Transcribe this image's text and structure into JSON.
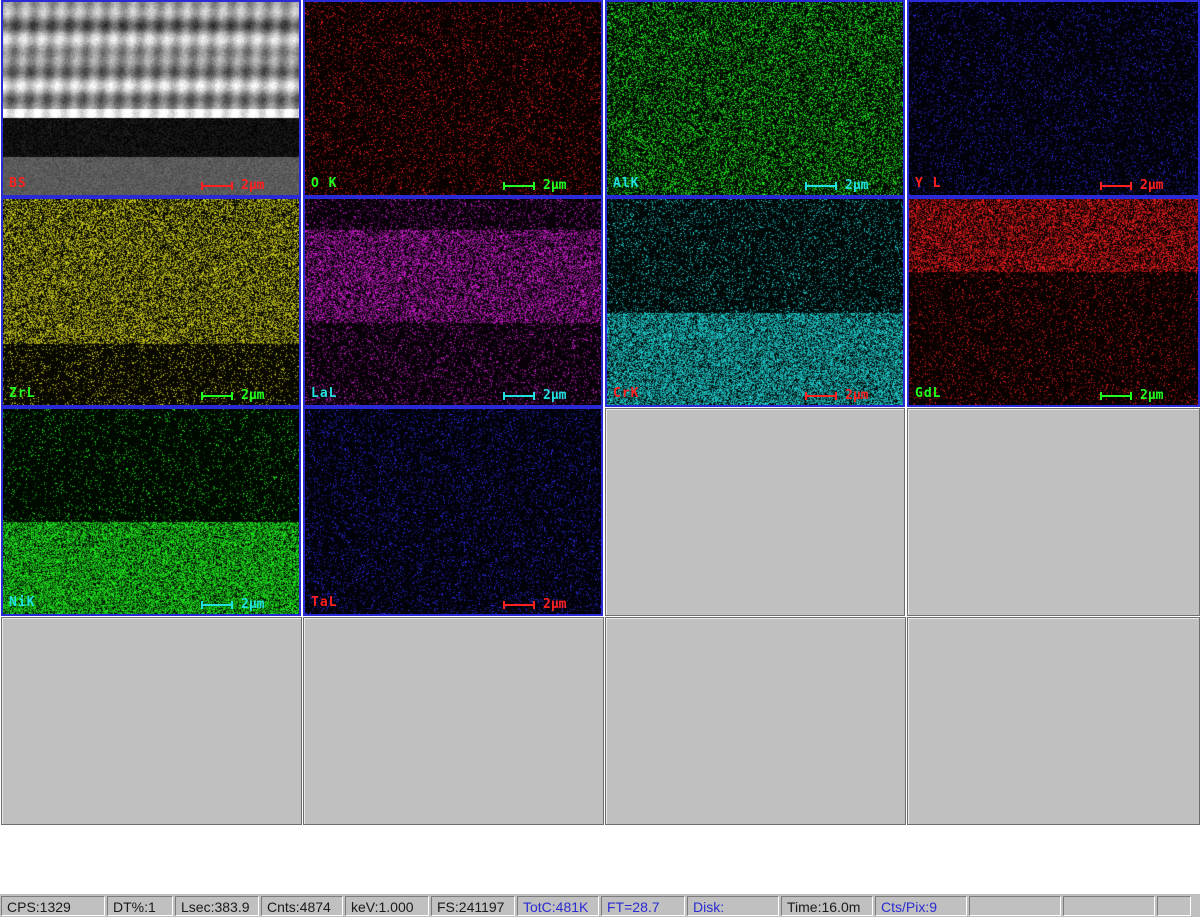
{
  "maps": [
    {
      "label": "BS",
      "label_color": "#ff2020",
      "scale_text": "2µm",
      "scale_color": "#ff2020",
      "tint": "#ffffff"
    },
    {
      "label": "O K",
      "label_color": "#20ff20",
      "scale_text": "2µm",
      "scale_color": "#20ff20",
      "tint": "#ff2020"
    },
    {
      "label": "AlK",
      "label_color": "#20e0e0",
      "scale_text": "2µm",
      "scale_color": "#20e0e0",
      "tint": "#20ff20"
    },
    {
      "label": "Y L",
      "label_color": "#ff2020",
      "scale_text": "2µm",
      "scale_color": "#ff2020",
      "tint": "#3030ff"
    },
    {
      "label": "ZrL",
      "label_color": "#20ff20",
      "scale_text": "2µm",
      "scale_color": "#20ff20",
      "tint": "#e0e020"
    },
    {
      "label": "LaL",
      "label_color": "#20e0e0",
      "scale_text": "2µm",
      "scale_color": "#20e0e0",
      "tint": "#e020e0"
    },
    {
      "label": "CrK",
      "label_color": "#ff2020",
      "scale_text": "2µm",
      "scale_color": "#ff2020",
      "tint": "#20e0e0"
    },
    {
      "label": "GdL",
      "label_color": "#20ff20",
      "scale_text": "2µm",
      "scale_color": "#20ff20",
      "tint": "#ff2020"
    },
    {
      "label": "NiK",
      "label_color": "#20e0e0",
      "scale_text": "2µm",
      "scale_color": "#20e0e0",
      "tint": "#20ff20"
    },
    {
      "label": "TaL",
      "label_color": "#ff2020",
      "scale_text": "2µm",
      "scale_color": "#ff2020",
      "tint": "#3030ff"
    }
  ],
  "status": {
    "cps": "CPS:1329",
    "dt": "DT%:1",
    "lsec": "Lsec:383.9",
    "cnts": "Cnts:4874",
    "kev": "keV:1.000",
    "fs": "FS:241197",
    "totc": "TotC:481K",
    "ft": "FT=28.7",
    "disk": "Disk:",
    "time": "Time:16.0m",
    "ctspix": "Cts/Pix:9"
  }
}
